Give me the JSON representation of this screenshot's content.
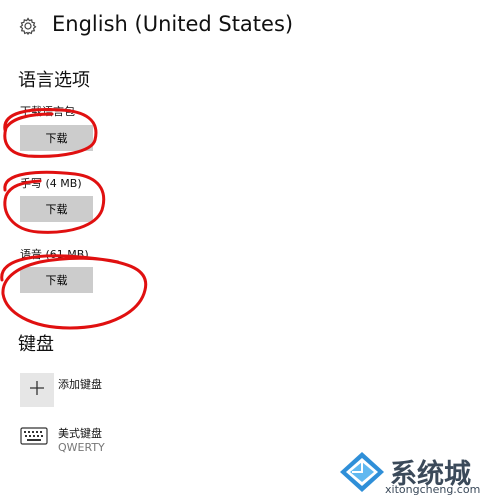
{
  "header": {
    "title": "English (United States)",
    "icon": "gear-icon"
  },
  "language_options": {
    "section_title": "语言选项",
    "items": [
      {
        "label": "下载语言包",
        "button_label": "下载"
      },
      {
        "label": "手写 (4 MB)",
        "button_label": "下载"
      },
      {
        "label": "语音 (61 MB)",
        "button_label": "下载"
      }
    ]
  },
  "keyboard": {
    "section_title": "键盘",
    "add_label": "添加键盘",
    "keyboards": [
      {
        "name": "美式键盘",
        "layout": "QWERTY",
        "icon": "keyboard-icon"
      }
    ]
  },
  "annotation_color": "#e01010",
  "watermark": {
    "brand": "系统城",
    "url": "xitongcheng.com"
  }
}
